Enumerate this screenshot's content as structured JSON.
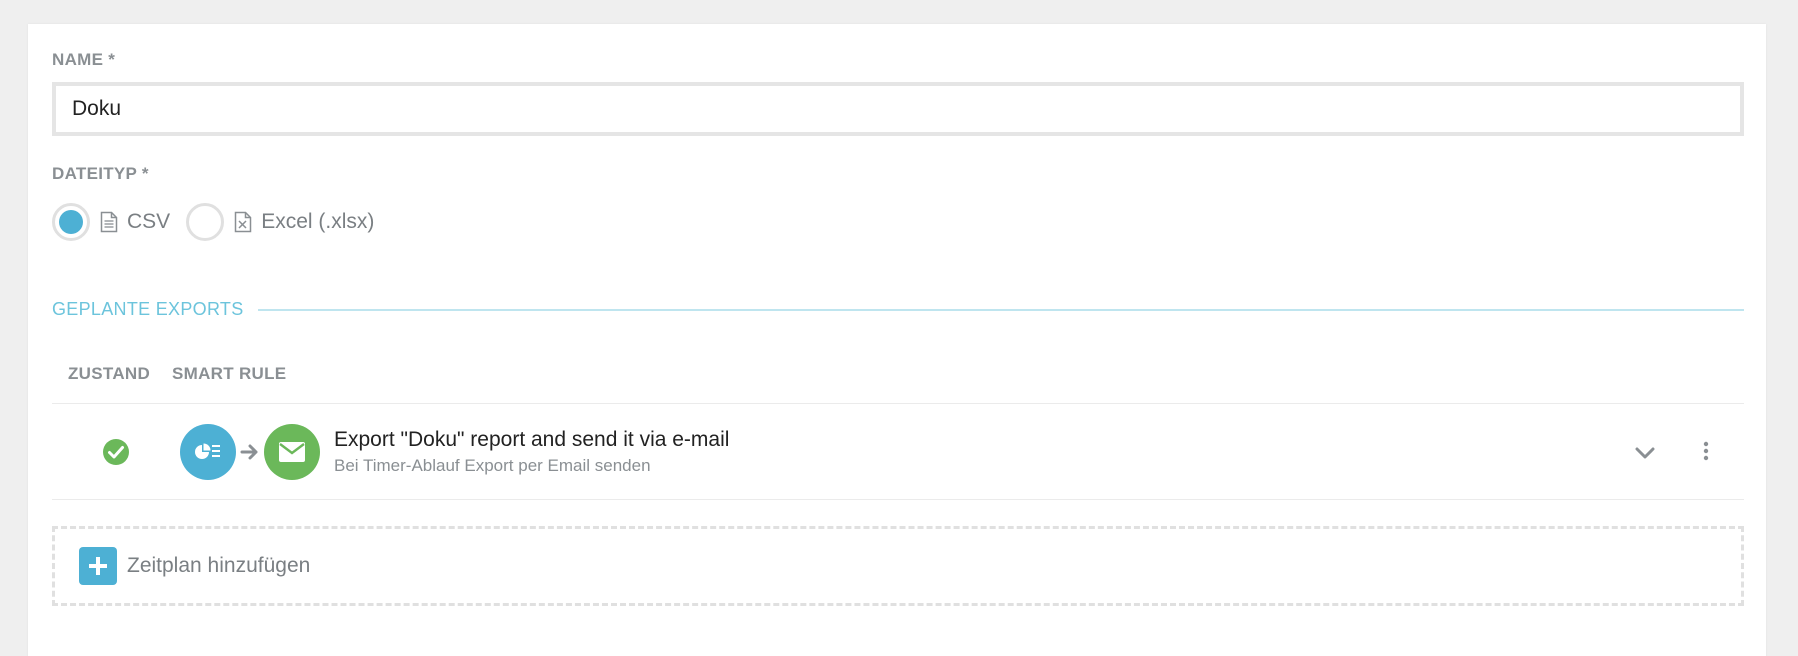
{
  "colors": {
    "accent": "#4db0d4",
    "success": "#6bb85a",
    "section_title": "#6cc4dc"
  },
  "form": {
    "name_label": "NAME *",
    "name_value": "Doku",
    "filetype_label": "DATEITYP *",
    "filetype_options": [
      {
        "label": "CSV",
        "icon": "document-icon",
        "selected": true
      },
      {
        "label": "Excel (.xlsx)",
        "icon": "excel-file-icon",
        "selected": false
      }
    ]
  },
  "scheduled_exports": {
    "section_title": "GEPLANTE EXPORTS",
    "columns": [
      "ZUSTAND",
      "SMART RULE"
    ],
    "rules": [
      {
        "state_icon": "check-circle-icon",
        "trigger_icon": "report-icon",
        "action_icon": "envelope-icon",
        "title": "Export \"Doku\" report and send it via e-mail",
        "subtitle": "Bei Timer-Ablauf Export per Email senden"
      }
    ],
    "add_label": "Zeitplan hinzufügen"
  }
}
